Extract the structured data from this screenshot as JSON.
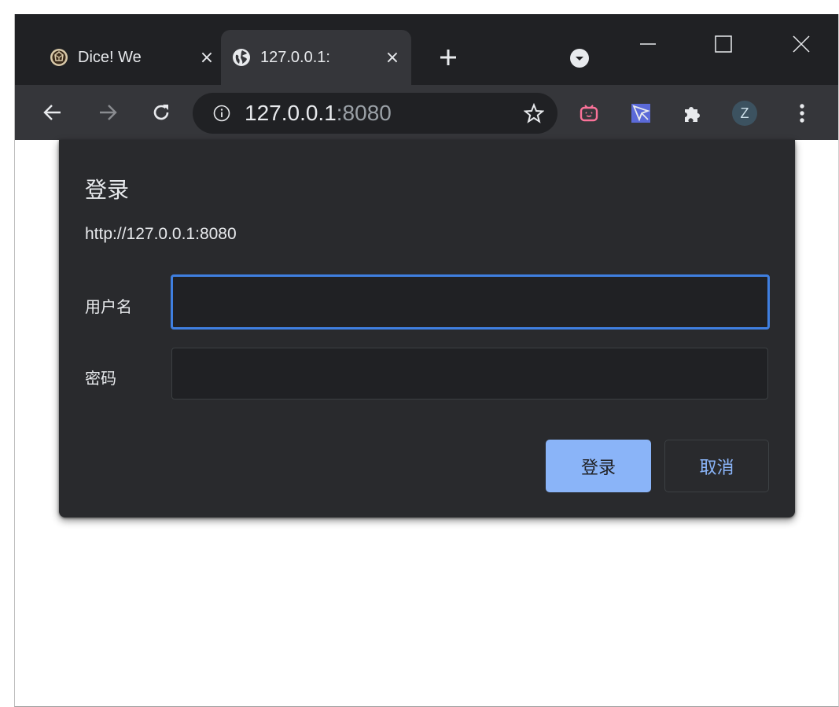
{
  "browser": {
    "tabs": [
      {
        "title": "Dice! We",
        "close": "×",
        "active": false,
        "favicon": "dice-logo-icon"
      },
      {
        "title": "127.0.0.1:",
        "close": "×",
        "active": true,
        "favicon": "globe-icon"
      }
    ],
    "new_tab": "+",
    "omnibox": {
      "host": "127.0.0.1",
      "port": ":8080"
    },
    "avatar_initial": "Z"
  },
  "dialog": {
    "title": "登录",
    "origin": "http://127.0.0.1:8080",
    "username_label": "用户名",
    "password_label": "密码",
    "username_value": "",
    "password_value": "",
    "login_button": "登录",
    "cancel_button": "取消"
  },
  "colors": {
    "titlebar": "#202124",
    "toolbar": "#35363a",
    "dialog_bg": "#292a2d",
    "focus_ring": "#3f7fe0",
    "accent": "#8ab4f8"
  }
}
